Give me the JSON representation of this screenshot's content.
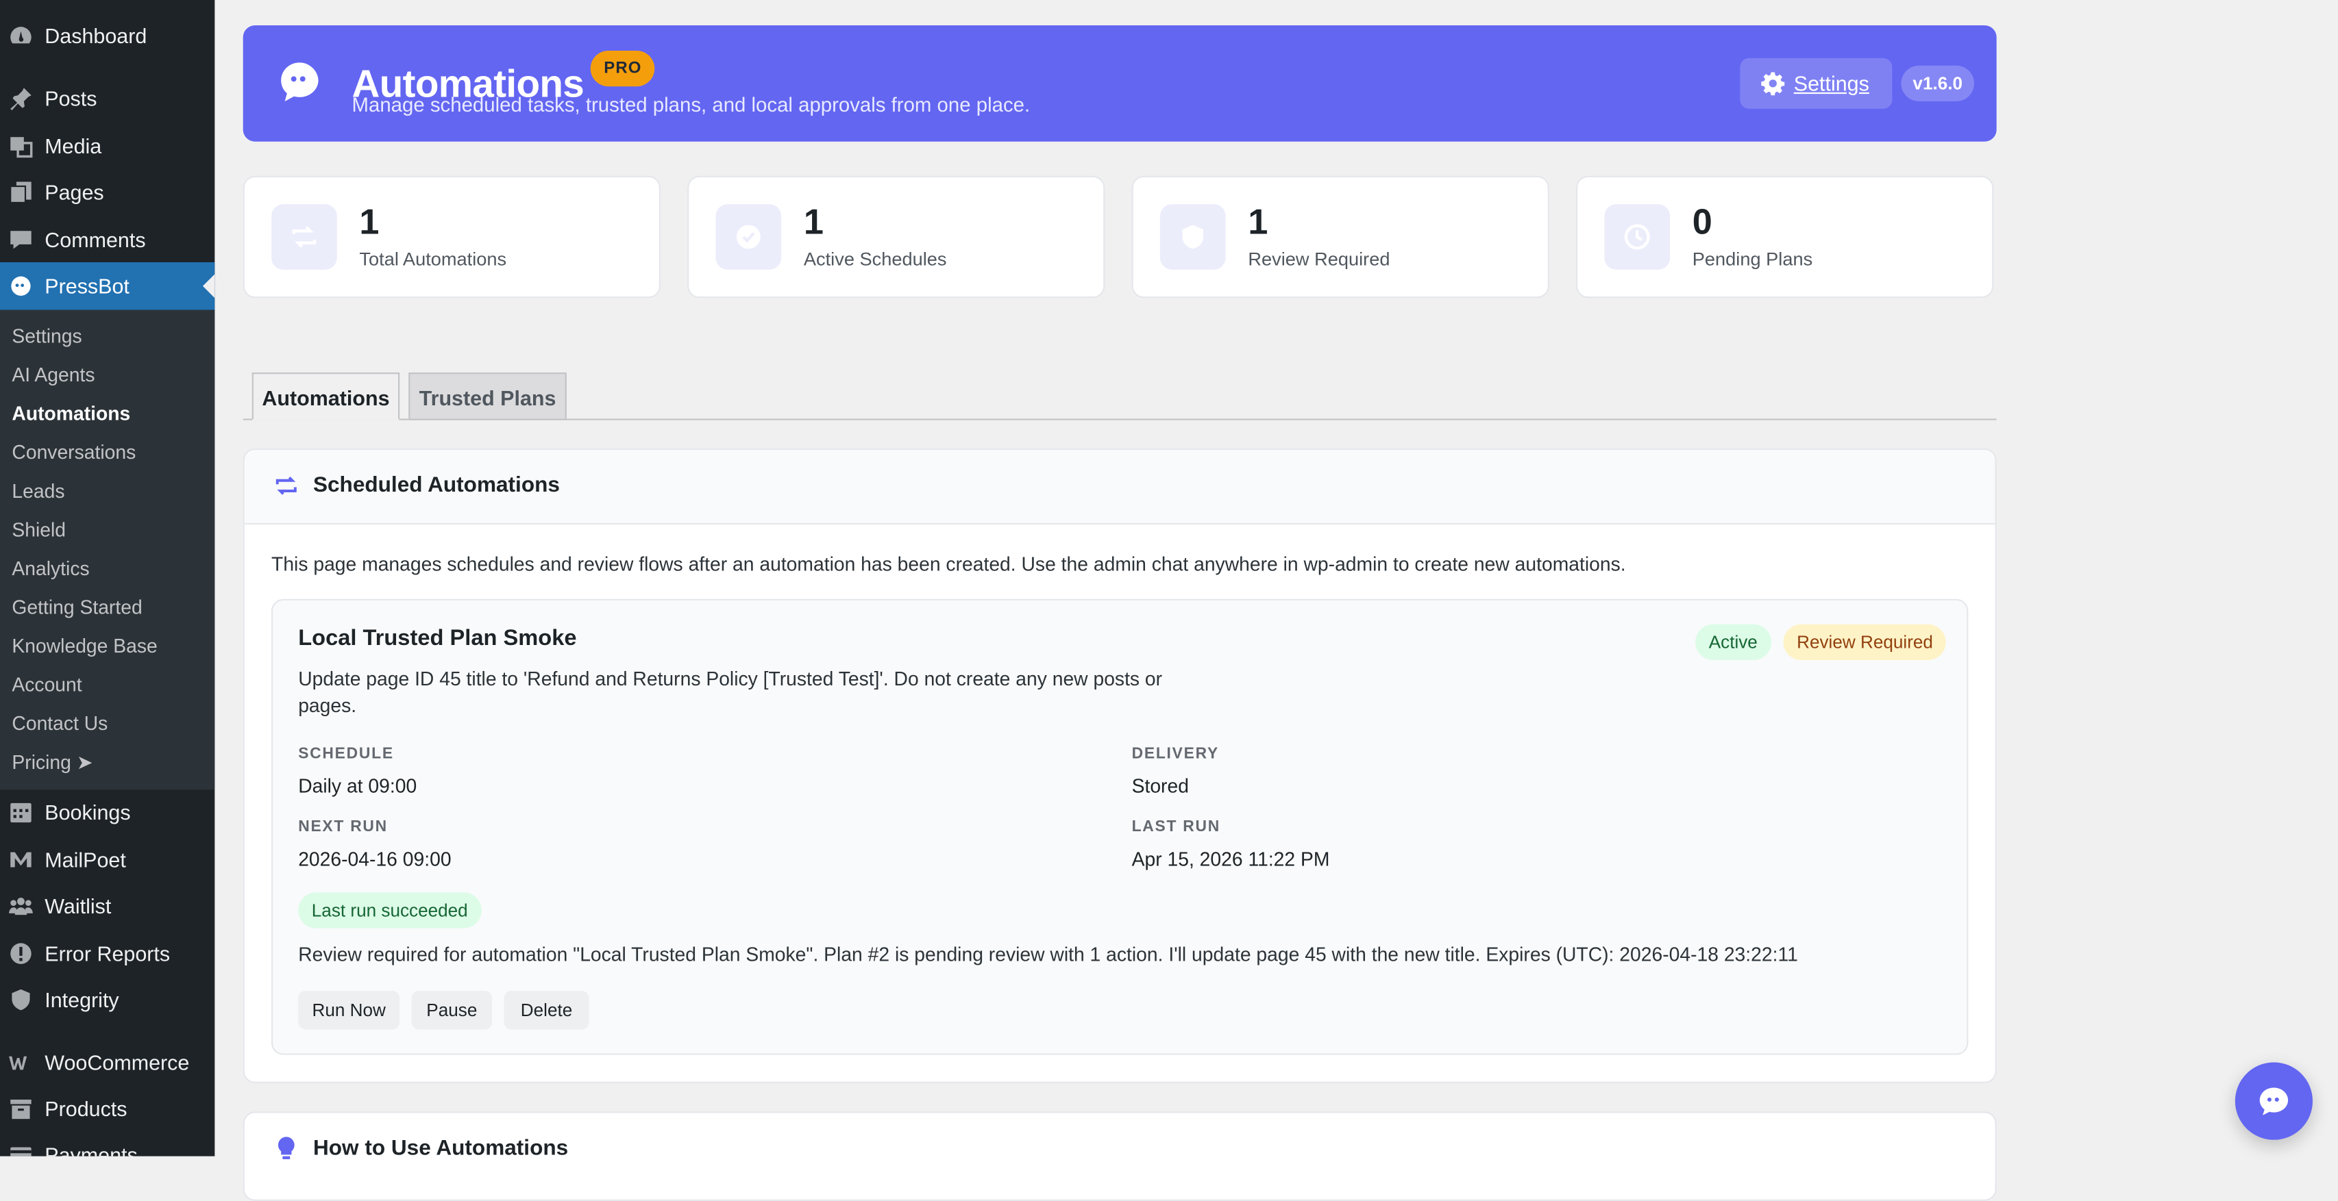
{
  "sidebar": {
    "dashboard": "Dashboard",
    "posts": "Posts",
    "media": "Media",
    "pages": "Pages",
    "comments": "Comments",
    "pressbot": "PressBot",
    "submenu": [
      "Settings",
      "AI Agents",
      "Automations",
      "Conversations",
      "Leads",
      "Shield",
      "Analytics",
      "Getting Started",
      "Knowledge Base",
      "Account",
      "Contact Us",
      "Pricing ➤"
    ],
    "bookings": "Bookings",
    "mailpoet": "MailPoet",
    "waitlist": "Waitlist",
    "error_reports": "Error Reports",
    "integrity": "Integrity",
    "woocommerce": "WooCommerce",
    "products": "Products",
    "payments": "Payments"
  },
  "header": {
    "title": "Automations",
    "badge": "PRO",
    "subtitle": "Manage scheduled tasks, trusted plans, and local approvals from one place.",
    "settings_label": "Settings",
    "version": "v1.6.0"
  },
  "stats": [
    {
      "value": "1",
      "label": "Total Automations"
    },
    {
      "value": "1",
      "label": "Active Schedules"
    },
    {
      "value": "1",
      "label": "Review Required"
    },
    {
      "value": "0",
      "label": "Pending Plans"
    }
  ],
  "tabs": [
    "Automations",
    "Trusted Plans"
  ],
  "panel": {
    "title": "Scheduled Automations",
    "intro": "This page manages schedules and review flows after an automation has been created. Use the admin chat anywhere in wp-admin to create new automations."
  },
  "automation": {
    "name": "Local Trusted Plan Smoke",
    "status_badge": "Active",
    "review_badge": "Review Required",
    "description": "Update page ID 45 title to 'Refund and Returns Policy [Trusted Test]'. Do not create any new posts or pages.",
    "schedule_label": "SCHEDULE",
    "schedule_value": "Daily at 09:00",
    "delivery_label": "DELIVERY",
    "delivery_value": "Stored",
    "next_run_label": "NEXT RUN",
    "next_run_value": "2026-04-16 09:00",
    "last_run_label": "LAST RUN",
    "last_run_value": "Apr 15, 2026 11:22 PM",
    "last_status": "Last run succeeded",
    "review_message": "Review required for automation \"Local Trusted Plan Smoke\". Plan #2 is pending review with 1 action. I'll update page 45 with the new title. Expires (UTC): 2026-04-18 23:22:11",
    "buttons": {
      "run": "Run Now",
      "pause": "Pause",
      "delete": "Delete"
    }
  },
  "help_panel": {
    "title": "How to Use Automations"
  },
  "colors": {
    "accent": "#6366f1",
    "wp_blue": "#2271b1",
    "sidebar_bg": "#1d2327",
    "pro_badge": "#f59e0b",
    "success_bg": "#dcfce7",
    "warning_bg": "#fef3c7"
  },
  "icons": {
    "header": "chat-bubble-icon",
    "settings": "gear-icon",
    "stats": [
      "repeat-icon",
      "check-circle-icon",
      "shield-icon",
      "clock-icon"
    ],
    "panel": "repeat-icon",
    "help": "lightbulb-icon",
    "fab": "chat-bubble-icon"
  }
}
